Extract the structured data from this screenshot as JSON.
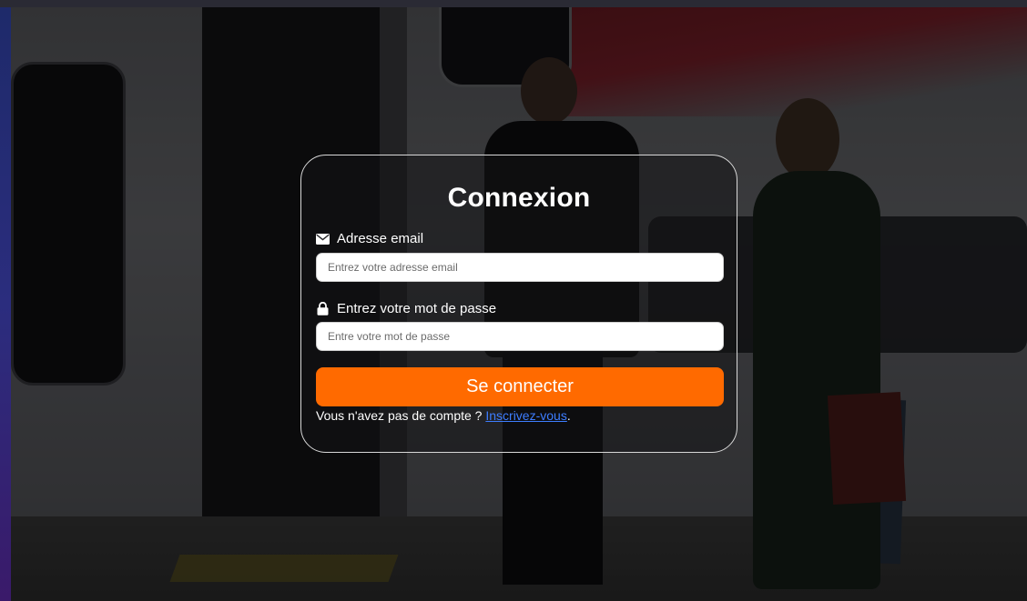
{
  "login": {
    "title": "Connexion",
    "email_label": "Adresse email",
    "email_placeholder": "Entrez votre adresse email",
    "email_icon": "envelope-icon",
    "password_label": "Entrez votre mot de passe",
    "password_placeholder": "Entre votre mot de passe",
    "password_icon": "lock-icon",
    "submit_label": "Se connecter",
    "signup_prompt": "Vous n'avez pas de compte ? ",
    "signup_link": "Inscrivez-vous",
    "signup_suffix": "."
  },
  "colors": {
    "accent": "#ff6a00",
    "link": "#3d7dff",
    "card_border": "#d8d8d8"
  }
}
